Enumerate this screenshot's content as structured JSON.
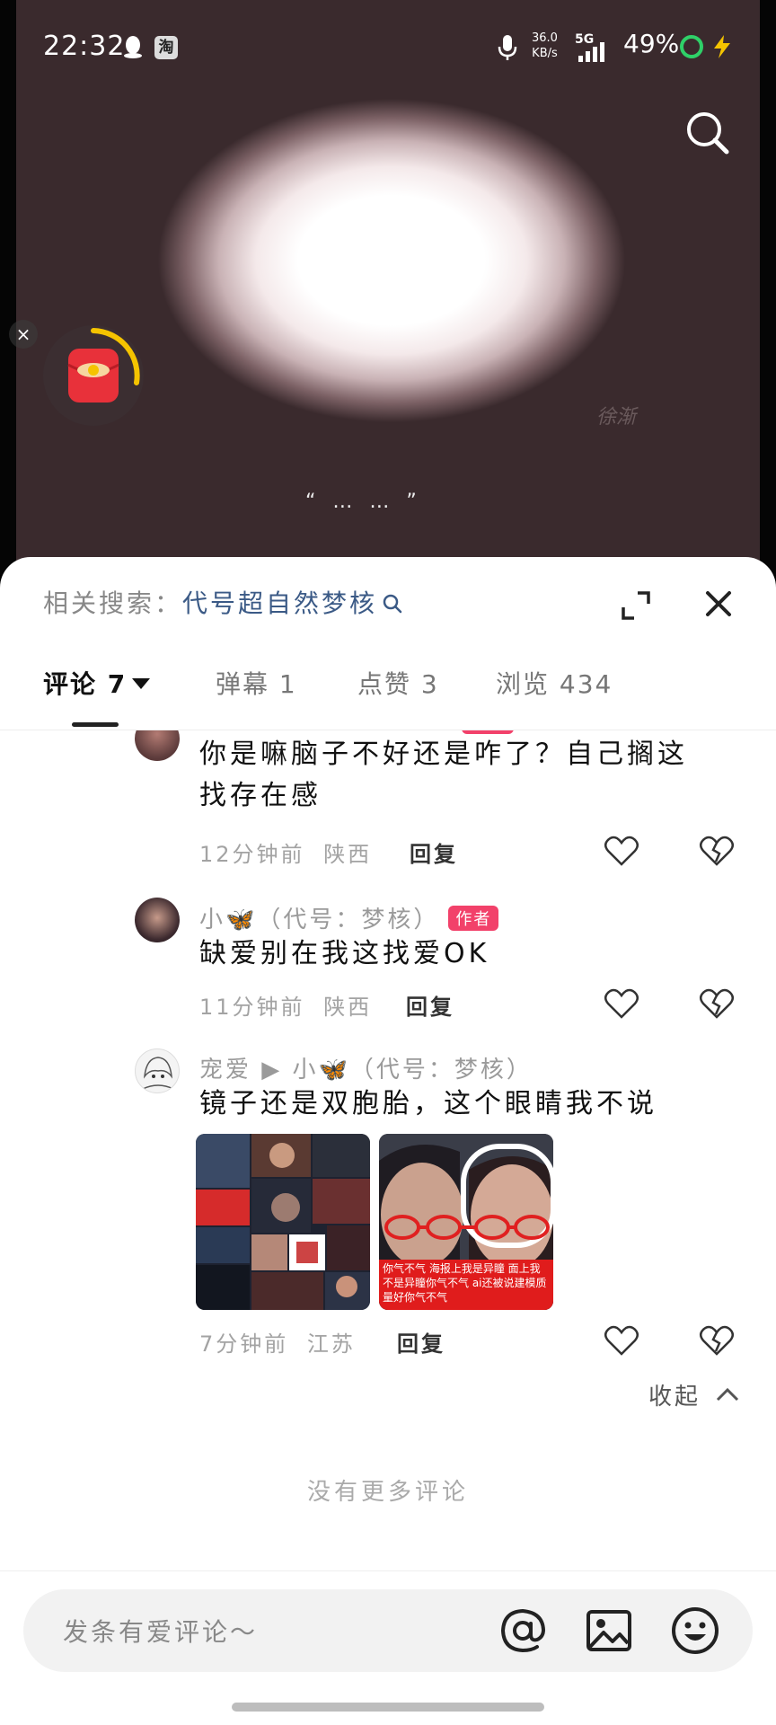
{
  "status_bar": {
    "time": "22:32",
    "taobao": "淘",
    "speed_value": "36.0",
    "speed_unit": "KB/s",
    "network": "5G",
    "battery": "49%"
  },
  "video": {
    "signature": "徐渐",
    "subtitle": "“ … … ”",
    "close_label": "×"
  },
  "sheet": {
    "related_label": "相关搜索：",
    "related_query": "代号超自然梦核",
    "tabs": [
      {
        "label": "评论",
        "count": "7"
      },
      {
        "label": "弹幕",
        "count": "1"
      },
      {
        "label": "点赞",
        "count": "3"
      },
      {
        "label": "浏览",
        "count": "434"
      }
    ]
  },
  "comments": [
    {
      "name": "",
      "text_line1": "你是嘛脑子不好还是咋了？自己搁这",
      "text_line2": "找存在感",
      "time": "12分钟前",
      "location": "陕西",
      "reply": "回复"
    },
    {
      "name": "小🦋（代号：梦核）",
      "badge": "作者",
      "text_line1": "缺爱别在我这找爱OK",
      "time": "11分钟前",
      "location": "陕西",
      "reply": "回复"
    },
    {
      "name": "宠爱 ▶ 小🦋（代号：梦核）",
      "text_line1": "镜子还是双胞胎，这个眼睛我不说",
      "image2_caption": "你气不气 海报上我是异瞳 面上我不是异瞳你气不气 ai还被说建模质量好你气不气",
      "time": "7分钟前",
      "location": "江苏",
      "reply": "回复"
    }
  ],
  "collapse_label": "收起",
  "no_more_label": "没有更多评论",
  "input": {
    "placeholder": "发条有爱评论～"
  },
  "colors": {
    "accent": "#f2416a",
    "related_query": "#3b5a86"
  },
  "icons": [
    "search-icon",
    "close-icon",
    "expand-icon",
    "like-icon",
    "dislike-icon",
    "at-icon",
    "image-icon",
    "emoji-icon",
    "red-packet-icon"
  ]
}
